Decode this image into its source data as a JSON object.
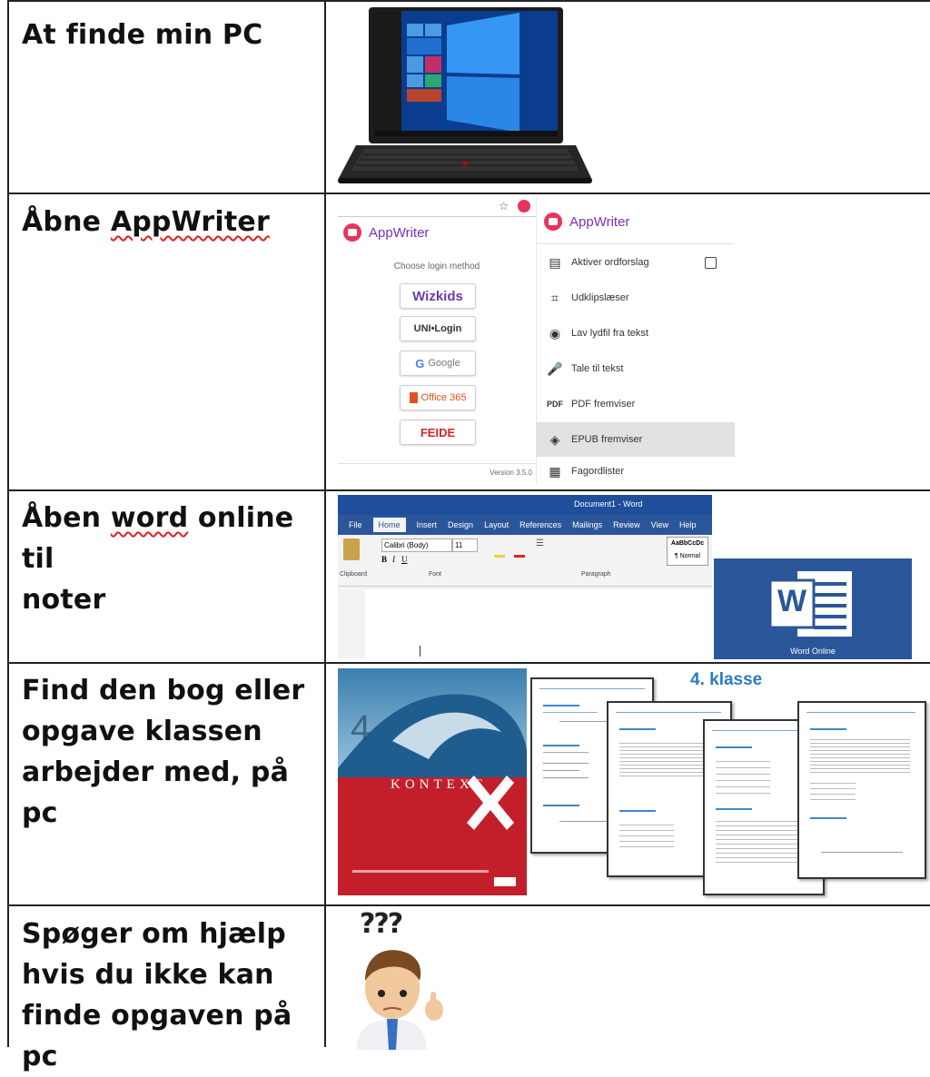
{
  "rows": [
    {
      "text": "At finde min PC"
    },
    {
      "text_prefix": "Åbne ",
      "text_squiggle": "AppWriter"
    },
    {
      "line1_prefix": "Åben ",
      "line1_squiggle": "word",
      "line1_suffix": " online til",
      "line2": "noter"
    },
    {
      "text": "Find den bog eller\nopgave klassen\narbejder med, på pc"
    },
    {
      "text": "Spøger om hjælp\nhvis du ikke kan\nfinde opgaven på pc"
    }
  ],
  "appwriter": {
    "brand": "AppWriter",
    "choose_login": "Choose login method",
    "login_options": [
      "Wizkids",
      "UNI•Login",
      "Google",
      "Office 365",
      "FEIDE"
    ],
    "version": "Version 3.5.0",
    "menu": [
      {
        "icon": "▤",
        "label": "Aktiver ordforslag"
      },
      {
        "icon": "⌗",
        "label": "Udklipslæser"
      },
      {
        "icon": "◉",
        "label": "Lav lydfil fra tekst"
      },
      {
        "icon": "🎤",
        "label": "Tale til tekst"
      },
      {
        "icon": "PDF",
        "label": "PDF fremviser"
      },
      {
        "icon": "◈",
        "label": "EPUB fremviser"
      },
      {
        "icon": "▦",
        "label": "Fagordlister"
      }
    ]
  },
  "word": {
    "title": "Document1 - Word",
    "tabs": [
      "File",
      "Home",
      "Insert",
      "Design",
      "Layout",
      "References",
      "Mailings",
      "Review",
      "View",
      "Help"
    ],
    "groups": [
      "Clipboard",
      "Font",
      "Paragraph"
    ],
    "font": "Calibri (Body)",
    "size": "11",
    "style": "¶ Normal",
    "logo_letter": "W",
    "logo_caption": "Word Online"
  },
  "book": {
    "title": "KONTEXT",
    "number": "4"
  },
  "worksheets": {
    "heading": "4. klasse"
  },
  "question": "???",
  "colors": {
    "word_blue": "#2b579a",
    "appwriter_pink": "#e6335e",
    "appwriter_purple": "#7b2fbe",
    "klasse_blue": "#2b7bc0",
    "book_red": "#c21f2a"
  }
}
